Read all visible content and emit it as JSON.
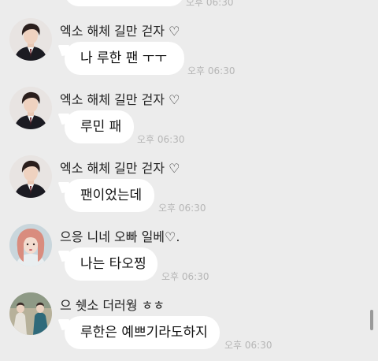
{
  "top": {
    "time": "오후 06:30"
  },
  "messages": [
    {
      "sender": "엑소 해체 길만 걷자 ♡",
      "text": "나 루한 팬 ㅜㅜ",
      "time": "오후 06:30",
      "avatar": "avatar-man-suit"
    },
    {
      "sender": "엑소 해체 길만 걷자 ♡",
      "text": "루민 패",
      "time": "오후 06:30",
      "avatar": "avatar-man-suit"
    },
    {
      "sender": "엑소 해체 길만 걷자 ♡",
      "text": "팬이었는데",
      "time": "오후 06:30",
      "avatar": "avatar-man-suit"
    },
    {
      "sender": "으응 니네 오빠 일베♡.",
      "text": "나는 타오찡",
      "time": "오후 06:30",
      "avatar": "avatar-girl-pink-hair"
    },
    {
      "sender": "으 쉣소 더러웡 ㅎㅎ",
      "text": "루한은 예쁘기라도하지",
      "time": "오후 06:30",
      "avatar": "avatar-group-photo"
    }
  ],
  "colors": {
    "background": "#ececec",
    "bubble": "#ffffff",
    "time": "#b6b6b6"
  }
}
